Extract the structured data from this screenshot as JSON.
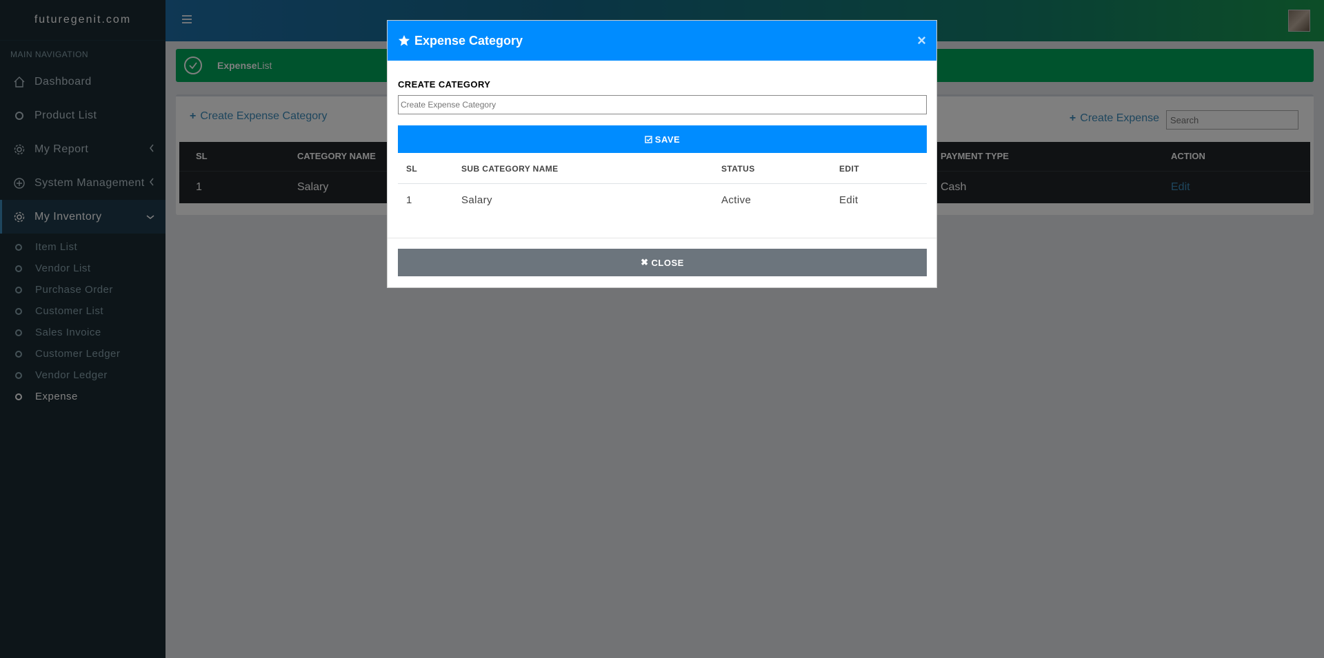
{
  "sidebar": {
    "brand": "futuregenit.com",
    "nav_header": "MAIN NAVIGATION",
    "items": [
      {
        "label": "Dashboard",
        "icon": "home-icon"
      },
      {
        "label": "Product List",
        "icon": "circle-icon"
      },
      {
        "label": "My Report",
        "icon": "gear-icon"
      },
      {
        "label": "System Management",
        "icon": "plus-circle-icon"
      },
      {
        "label": "My Inventory",
        "icon": "gear-icon"
      }
    ],
    "sub_items": [
      {
        "label": "Item List"
      },
      {
        "label": "Vendor List"
      },
      {
        "label": "Purchase Order"
      },
      {
        "label": "Customer List"
      },
      {
        "label": "Sales Invoice"
      },
      {
        "label": "Customer Ledger"
      },
      {
        "label": "Vendor Ledger"
      },
      {
        "label": "Expense"
      }
    ]
  },
  "alert": {
    "bold": "Expense",
    "rest": "List"
  },
  "main": {
    "create_category_label": "Create Expense Category",
    "create_expense_label": "Create Expense",
    "search_placeholder": "Search",
    "table": {
      "headers": [
        "SL",
        "CATEGORY NAME",
        "PAYMENT TYPE",
        "ACTION"
      ],
      "rows": [
        {
          "sl": "1",
          "category": "Salary",
          "payment": "Cash",
          "action": "Edit"
        }
      ]
    }
  },
  "modal": {
    "title": "Expense Category",
    "close_x": "×",
    "field_label": "CREATE CATEGORY",
    "field_placeholder": "Create Expense Category",
    "save_label": "SAVE",
    "table": {
      "headers": [
        "SL",
        "SUB CATEGORY NAME",
        "STATUS",
        "EDIT"
      ],
      "rows": [
        {
          "sl": "1",
          "name": "Salary",
          "status": "Active",
          "edit": "Edit"
        }
      ]
    },
    "close_label": "CLOSE"
  },
  "colors": {
    "modal_header": "#008cff",
    "alert_bg": "#00a65a",
    "sidebar_bg": "#1a2a33"
  }
}
